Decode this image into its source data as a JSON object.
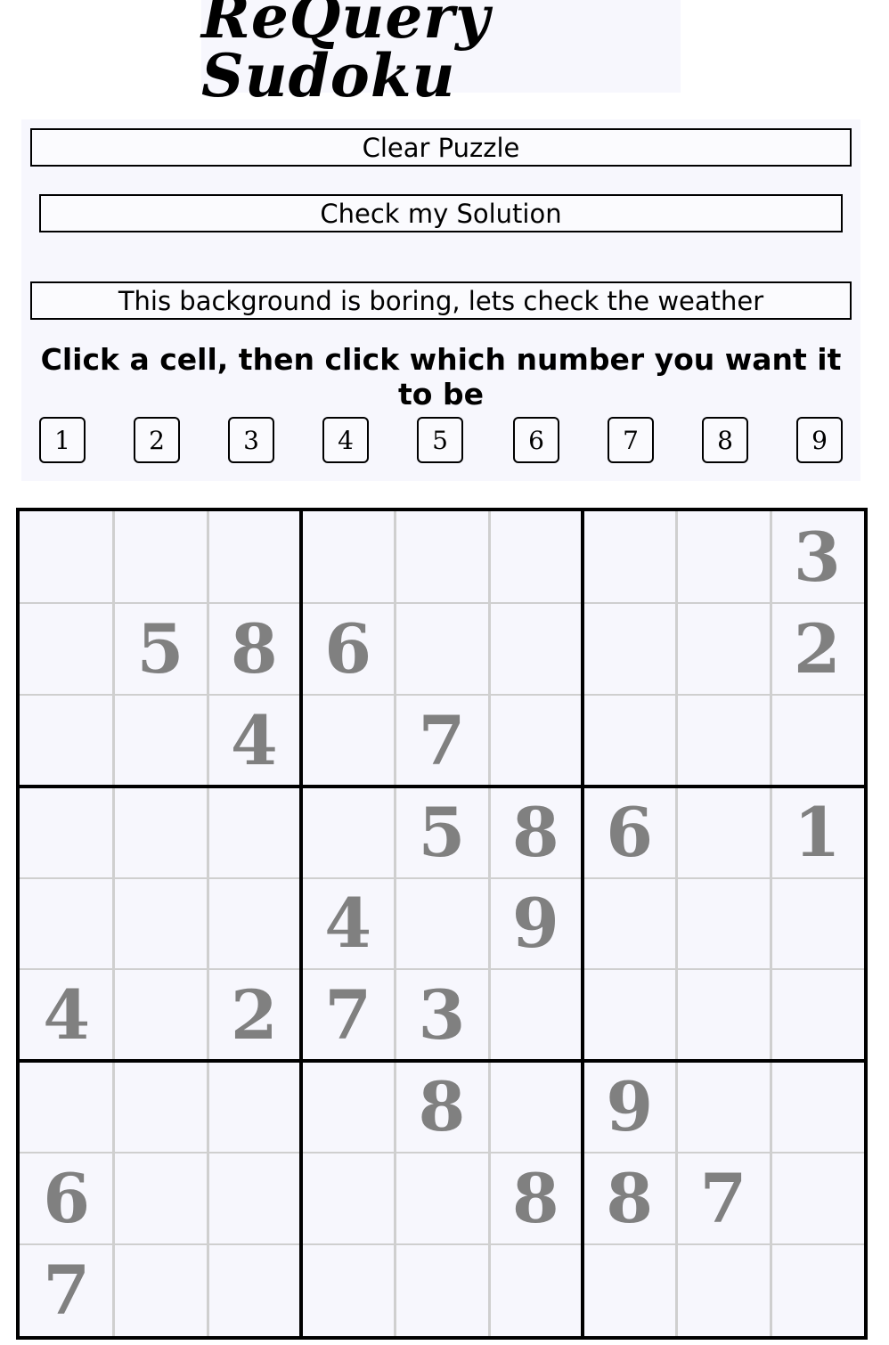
{
  "header": {
    "title": "ReQuery Sudoku"
  },
  "controls": {
    "clear_label": "Clear Puzzle",
    "check_label": "Check my Solution",
    "weather_label": "This background is boring, lets check the weather",
    "instruction": "Click a cell, then click which number you want it to be",
    "number_buttons": [
      "1",
      "2",
      "3",
      "4",
      "5",
      "6",
      "7",
      "8",
      "9"
    ]
  },
  "board": {
    "cells": [
      [
        "",
        "",
        "",
        "",
        "",
        "",
        "",
        "",
        "3"
      ],
      [
        "",
        "5",
        "8",
        "6",
        "",
        "",
        "",
        "",
        "2"
      ],
      [
        "",
        "",
        "4",
        "",
        "7",
        "",
        "",
        "",
        ""
      ],
      [
        "",
        "",
        "",
        "",
        "5",
        "8",
        "6",
        "",
        "1"
      ],
      [
        "",
        "",
        "",
        "4",
        "",
        "9",
        "",
        "",
        ""
      ],
      [
        "4",
        "",
        "2",
        "7",
        "3",
        "",
        "",
        "",
        ""
      ],
      [
        "",
        "",
        "",
        "",
        "8",
        "",
        "9",
        "",
        ""
      ],
      [
        "6",
        "",
        "",
        "",
        "",
        "8",
        "8",
        "7",
        ""
      ],
      [
        "7",
        "",
        "",
        "",
        "",
        "",
        "",
        "",
        ""
      ]
    ],
    "digit_color": "#808080",
    "grid_color": "#cfcfcf",
    "box_border_color": "#000000"
  },
  "colors": {
    "panel_background": "#f7f7fd"
  }
}
